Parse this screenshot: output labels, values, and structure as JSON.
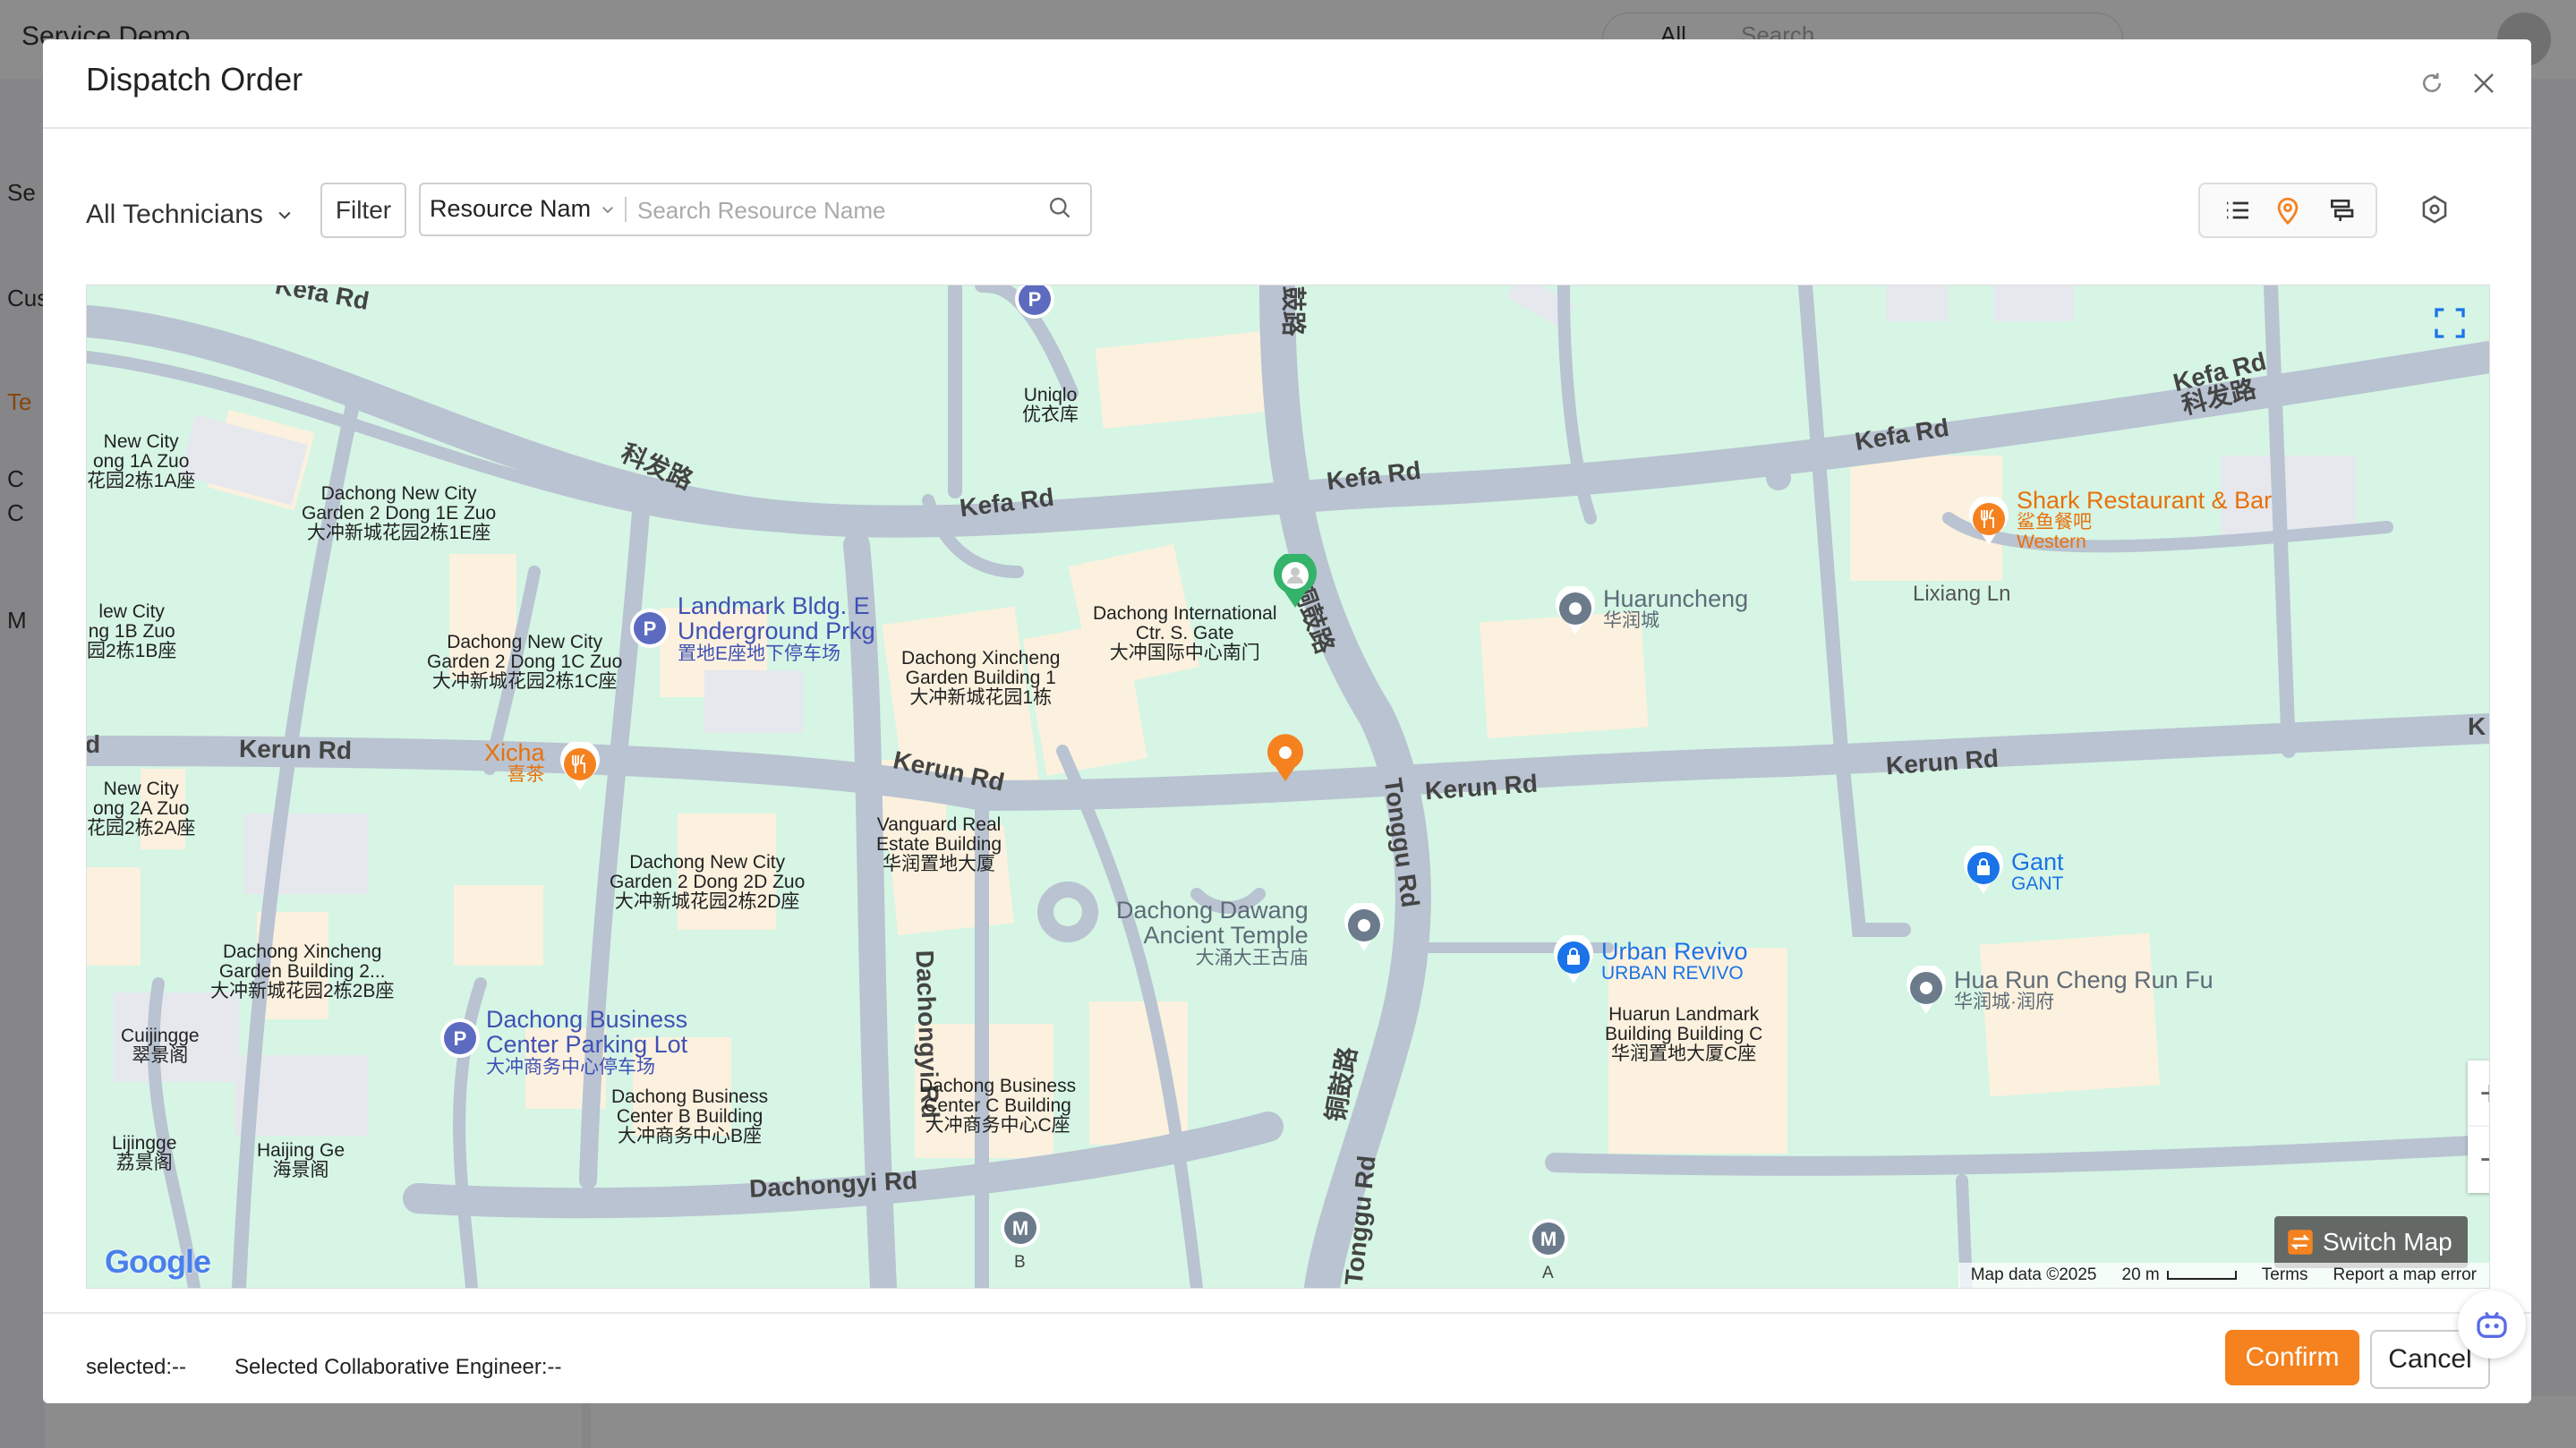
{
  "background_app": {
    "title": "Service Demo",
    "search_scope": "All",
    "search_placeholder": "Search",
    "sidebar_letters": [
      "Se",
      "Cus",
      "Te",
      "C",
      "C",
      "M"
    ]
  },
  "modal": {
    "title": "Dispatch Order",
    "refresh_icon": "refresh-icon",
    "close_icon": "close-icon"
  },
  "toolbar": {
    "technician_select": "All Technicians",
    "filter_label": "Filter",
    "search_type": "Resource Nam",
    "search_placeholder": "Search Resource Name",
    "view_modes": [
      "list-icon",
      "map-pin-icon",
      "gantt-icon"
    ],
    "active_view": "map-pin-icon",
    "settings_icon": "settings-icon"
  },
  "map": {
    "roads": {
      "kefa_1": "Kefa Rd",
      "kefa_2": "Kefa Rd",
      "kefa_3": "Kefa Rd",
      "kefa_4": "Kefa Rd",
      "kefa_cn_1": "科发路",
      "kefa_cn_2": "科发路",
      "kerun_1": "Kerun Rd",
      "kerun_2": "Kerun Rd",
      "kerun_3": "Kerun Rd",
      "kerun_k": "K",
      "tonggu": "Tonggu Rd",
      "tonggu_2": "Tonggu Rd",
      "tonggu_cn": "铜鼓路",
      "tonggu_cn_2": "铜鼓路",
      "tonggu_cn_top": "鼓路",
      "dachongyi_1": "Dachongyi Rd",
      "dachongyi_2": "Dachongyi Rd",
      "lixiang": "Lixiang Ln",
      "kefa_top_left": "Kefa Rd",
      "kerun_left": "d"
    },
    "buildings": {
      "uniqlo": "Uniqlo\n优衣库",
      "new_city_1a": "New City\nong 1A Zuo\n花园2栋1A座",
      "dachong_1e": "Dachong New City\nGarden 2 Dong 1E Zuo\n大冲新城花园2栋1E座",
      "new_city_1b": "lew City\nng 1B Zuo\n园2栋1B座",
      "dachong_1c": "Dachong New City\nGarden 2 Dong 1C Zuo\n大冲新城花园2栋1C座",
      "xincheng_1": "Dachong Xincheng\nGarden Building 1\n大冲新城花园1栋",
      "intl_gate": "Dachong International\nCtr. S. Gate\n大冲国际中心南门",
      "new_city_2a": "New City\nong 2A Zuo\n花园2栋2A座",
      "vanguard": "Vanguard Real\nEstate Building\n华润置地大厦",
      "dachong_2d": "Dachong New City\nGarden 2 Dong 2D Zuo\n大冲新城花园2栋2D座",
      "xincheng_2b": "Dachong Xincheng\nGarden Building 2...\n大冲新城花园2栋2B座",
      "cuijingge": "Cuijingge\n翠景阁",
      "lijingge": "Lijingge\n荔景阁",
      "haijingge": "Haijing Ge\n海景阁",
      "business_b": "Dachong Business\nCenter B Building\n大冲商务中心B座",
      "business_c": "Dachong Business\nCenter C Building\n大冲商务中心C座",
      "huarun_c": "Huarun Landmark\nBuilding Building C\n华润置地大厦C座"
    },
    "pois": {
      "landmark_parking": {
        "name": "Landmark Bldg. E\nUnderground Prkg",
        "sub": "置地E座地下停车场"
      },
      "xicha": {
        "name": "Xicha",
        "sub": "喜茶"
      },
      "huaruncheng": {
        "name": "Huaruncheng",
        "sub": "华润城"
      },
      "shark": {
        "name": "Shark Restaurant & Bar",
        "sub": "鲨鱼餐吧\nWestern"
      },
      "temple": {
        "name": "Dachong Dawang\nAncient Temple",
        "sub": "大涌大王古庙"
      },
      "gant": {
        "name": "Gant",
        "sub": "GANT"
      },
      "urban_revivo": {
        "name": "Urban Revivo",
        "sub": "URBAN REVIVO"
      },
      "hua_run_cheng_run_fu": {
        "name": "Hua Run Cheng Run Fu",
        "sub": "华润城·润府"
      },
      "business_parking": {
        "name": "Dachong Business\nCenter Parking Lot",
        "sub": "大冲商务中心停车场"
      },
      "metro_b": "B",
      "metro_a": "A",
      "metro_letter": "M",
      "parking_letter": "P"
    },
    "controls": {
      "zoom_in": "+",
      "zoom_out": "−",
      "switch_map": "Switch Map",
      "google_logo": "Google",
      "map_data": "Map data ©2025",
      "scale": "20 m",
      "terms": "Terms",
      "report": "Report a map error"
    },
    "colors": {
      "land": "#d6f5e5",
      "road": "#b9c3d1",
      "building": "#fbf1de",
      "technician_pin": "#34b36b",
      "order_pin": "#f5821f",
      "poi_blue": "#1a73e8"
    }
  },
  "footer": {
    "selected": "selected:--",
    "selected_collab": "Selected Collaborative Engineer:--",
    "confirm": "Confirm",
    "cancel": "Cancel",
    "assistant_icon": "robot-icon"
  },
  "colors": {
    "accent": "#f5821f",
    "overlay": "rgba(0,0,0,0.45)"
  }
}
